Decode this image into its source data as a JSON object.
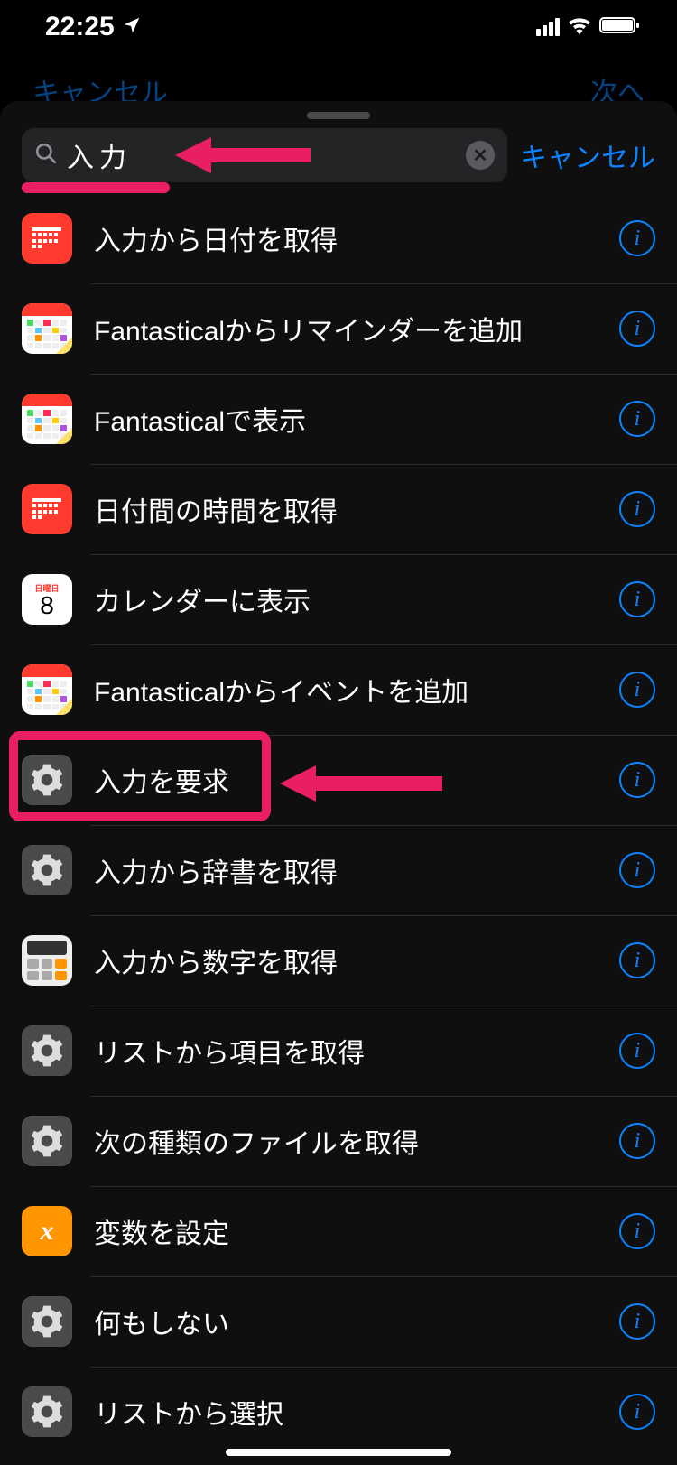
{
  "status": {
    "time": "22:25"
  },
  "behind": {
    "left": "キャンセル",
    "right": "次へ"
  },
  "search": {
    "value": "入力",
    "cancel": "キャンセル"
  },
  "calendar_day": {
    "dow": "日曜日",
    "num": "8"
  },
  "actions": [
    {
      "icon": "cal-red",
      "label": "入力から日付を取得"
    },
    {
      "icon": "fant",
      "label": "Fantasticalからリマインダーを追加"
    },
    {
      "icon": "fant",
      "label": "Fantasticalで表示"
    },
    {
      "icon": "cal-red",
      "label": "日付間の時間を取得"
    },
    {
      "icon": "day",
      "label": "カレンダーに表示"
    },
    {
      "icon": "fant",
      "label": "Fantasticalからイベントを追加"
    },
    {
      "icon": "gear",
      "label": "入力を要求"
    },
    {
      "icon": "gear",
      "label": "入力から辞書を取得"
    },
    {
      "icon": "calc",
      "label": "入力から数字を取得"
    },
    {
      "icon": "gear",
      "label": "リストから項目を取得"
    },
    {
      "icon": "gear",
      "label": "次の種類のファイルを取得"
    },
    {
      "icon": "var",
      "label": "変数を設定"
    },
    {
      "icon": "gear",
      "label": "何もしない"
    },
    {
      "icon": "gear",
      "label": "リストから選択"
    }
  ]
}
